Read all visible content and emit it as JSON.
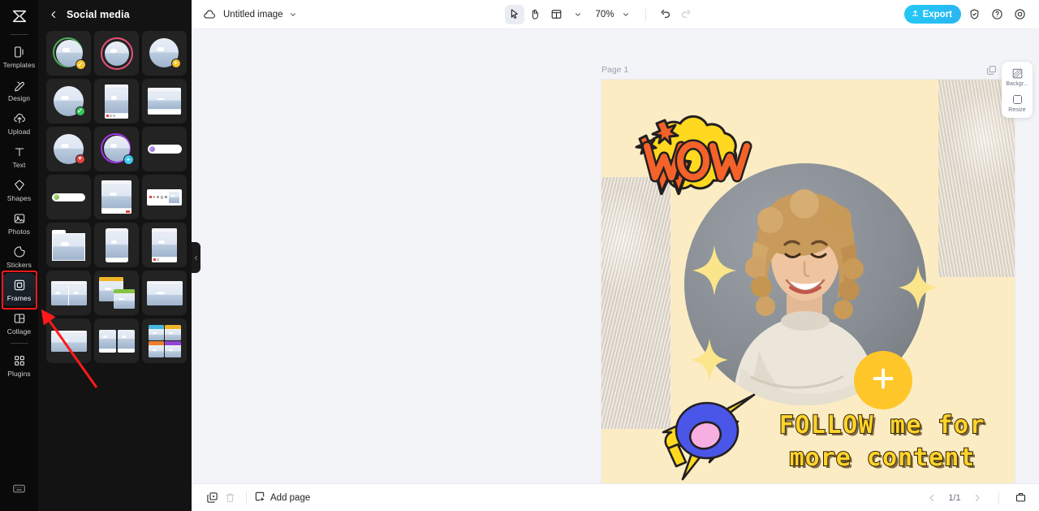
{
  "app": {
    "logo_icon": "capcut-logo-icon",
    "keyboard_shortcut_icon": "keyboard-icon"
  },
  "rail": {
    "items": [
      {
        "label": "Templates",
        "icon": "templates-icon",
        "active": false
      },
      {
        "label": "Design",
        "icon": "design-icon",
        "active": false
      },
      {
        "label": "Upload",
        "icon": "upload-icon",
        "active": false
      },
      {
        "label": "Text",
        "icon": "text-icon",
        "active": false
      },
      {
        "label": "Shapes",
        "icon": "shapes-icon",
        "active": false
      },
      {
        "label": "Photos",
        "icon": "photos-icon",
        "active": false
      },
      {
        "label": "Stickers",
        "icon": "stickers-icon",
        "active": false
      },
      {
        "label": "Frames",
        "icon": "frames-icon",
        "active": true
      },
      {
        "label": "Collage",
        "icon": "collage-icon",
        "active": false
      },
      {
        "label": "Plugins",
        "icon": "plugins-icon",
        "active": false
      }
    ]
  },
  "panel": {
    "title": "Social media",
    "back_icon": "chevron-left-icon",
    "collapse_icon": "chevron-left-icon",
    "thumbnails": [
      {
        "id": 1,
        "kind": "circle-ring",
        "ring": "#4fae5a",
        "badge": "#f5c32c",
        "badge_glyph": "✓"
      },
      {
        "id": 2,
        "kind": "circle-ring",
        "ring": "#e8527a",
        "badge": "",
        "badge_glyph": ""
      },
      {
        "id": 3,
        "kind": "circle-plain",
        "ring": "",
        "badge": "#f5c32c",
        "badge_glyph": "+"
      },
      {
        "id": 4,
        "kind": "circle-plain",
        "ring": "",
        "badge": "#35c759",
        "badge_glyph": "✓"
      },
      {
        "id": 5,
        "kind": "post-tall",
        "ring": "",
        "badge": "",
        "badge_glyph": ""
      },
      {
        "id": 6,
        "kind": "post-wide",
        "ring": "",
        "badge": "",
        "badge_glyph": ""
      },
      {
        "id": 7,
        "kind": "circle-plain",
        "ring": "",
        "badge": "#e8453c",
        "badge_glyph": "♥"
      },
      {
        "id": 8,
        "kind": "circle-ring",
        "ring": "#a338e8",
        "badge": "#3ec8ef",
        "badge_glyph": "+"
      },
      {
        "id": 9,
        "kind": "pill-right",
        "ring": "",
        "badge": "",
        "badge_glyph": ""
      },
      {
        "id": 10,
        "kind": "pill-left",
        "ring": "",
        "badge": "",
        "badge_glyph": ""
      },
      {
        "id": 11,
        "kind": "post-tall2",
        "ring": "",
        "badge": "",
        "badge_glyph": ""
      },
      {
        "id": 12,
        "kind": "card-wide",
        "ring": "",
        "badge": "",
        "badge_glyph": ""
      },
      {
        "id": 13,
        "kind": "folder",
        "ring": "",
        "badge": "",
        "badge_glyph": ""
      },
      {
        "id": 14,
        "kind": "phone",
        "ring": "",
        "badge": "",
        "badge_glyph": ""
      },
      {
        "id": 15,
        "kind": "post-tall3",
        "ring": "",
        "badge": "",
        "badge_glyph": ""
      },
      {
        "id": 16,
        "kind": "split-two",
        "ring": "",
        "badge": "",
        "badge_glyph": ""
      },
      {
        "id": 17,
        "kind": "two-windows",
        "ring": "",
        "badge": "",
        "badge_glyph": ""
      },
      {
        "id": 18,
        "kind": "wide-split",
        "ring": "",
        "badge": "",
        "badge_glyph": ""
      },
      {
        "id": 19,
        "kind": "wide-photo",
        "ring": "",
        "badge": "",
        "badge_glyph": ""
      },
      {
        "id": 20,
        "kind": "duo-photo",
        "ring": "",
        "badge": "",
        "badge_glyph": ""
      },
      {
        "id": 21,
        "kind": "quad-color",
        "ring": "",
        "badge": "",
        "badge_glyph": ""
      }
    ]
  },
  "topbar": {
    "cloud_icon": "cloud-icon",
    "doc_name": "Untitled image",
    "doc_caret_icon": "chevron-down-icon",
    "select_tool_icon": "cursor-arrow-icon",
    "hand_tool_icon": "hand-icon",
    "layout_tool_icon": "layout-icon",
    "layout_caret_icon": "chevron-down-icon",
    "zoom_level": "70%",
    "zoom_caret_icon": "chevron-down-icon",
    "undo_icon": "undo-icon",
    "redo_icon": "redo-icon",
    "export_label": "Export",
    "export_icon": "export-upload-icon",
    "export_color": "#25c4f4",
    "shield_icon": "shield-check-icon",
    "help_icon": "question-circle-icon",
    "settings_icon": "settings-gear-icon"
  },
  "stage": {
    "page_label": "Page 1",
    "duplicate_page_icon": "duplicate-icon",
    "more_options_icon": "more-horizontal-icon"
  },
  "side_panel": {
    "items": [
      {
        "label": "Backgr...",
        "icon": "background-icon"
      },
      {
        "label": "Resize",
        "icon": "resize-icon"
      }
    ]
  },
  "design": {
    "background_color": "#fcecc4",
    "wow_text": "WOW",
    "wow_text_color": "#f4622a",
    "wow_bubble_color": "#ffd91f",
    "headline_line1": "FOLLOW me for",
    "headline_line2": "more content",
    "headline_color": "#ffd42a",
    "headline_outline_color": "#2b1c06",
    "plus_button_icon": "plus-icon",
    "plus_button_color": "#ffc629",
    "megaphone_color": "#4a56e8",
    "sparkle_color": "#fbe58a",
    "portrait_alt": "smiling woman with curly blonde hair in cream sweater",
    "fabric_alt": "beige draped fabric texture"
  },
  "bottombar": {
    "duplicate_icon": "duplicate-page-icon",
    "delete_icon": "trash-icon",
    "add_page_label": "Add page",
    "add_page_icon": "add-page-icon",
    "prev_icon": "chevron-left-icon",
    "page_counter": "1/1",
    "next_icon": "chevron-right-icon",
    "grid_view_icon": "pages-grid-icon"
  },
  "annotation": {
    "highlight_color": "#ff1a1a",
    "target": "Frames"
  }
}
